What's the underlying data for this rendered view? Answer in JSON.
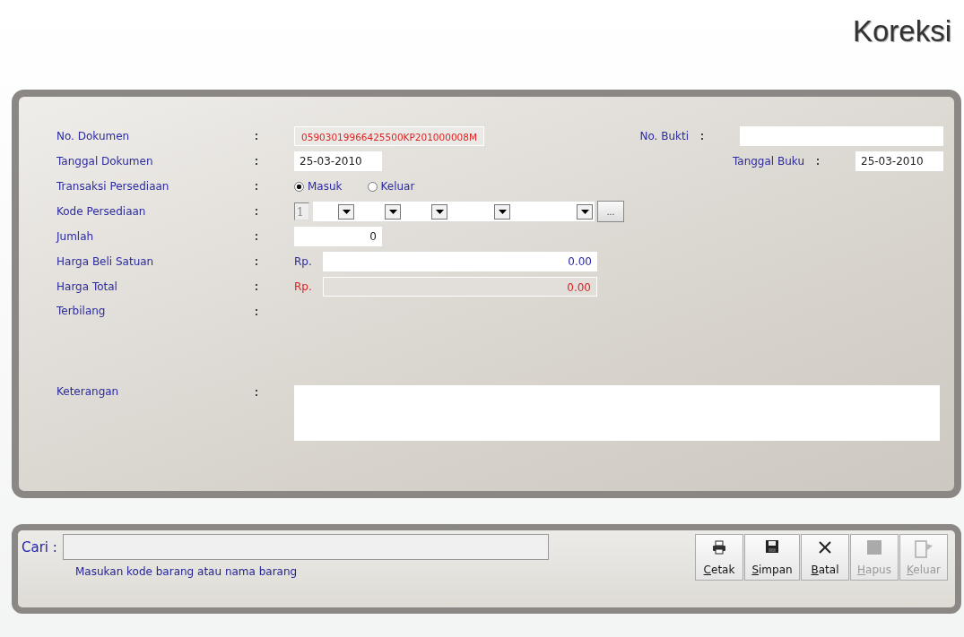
{
  "title": "Koreksi",
  "form": {
    "rows": [
      {
        "kind": "readonly",
        "label": "No. Dokumen",
        "value": "05903019966425500KP201000008M",
        "side": {
          "label": "No. Bukti"
        }
      },
      {
        "kind": "date",
        "label": "Tanggal Dokumen",
        "value": "25-03-2010",
        "side": {
          "label": "Tanggal Buku",
          "value": "25-03-2010"
        }
      },
      {
        "kind": "radio",
        "label": "Transaksi Persediaan",
        "options": [
          {
            "label": "Masuk",
            "selected": true
          },
          {
            "label": "Keluar",
            "selected": false
          }
        ]
      },
      {
        "kind": "code",
        "label": "Kode Persediaan",
        "prefix": "1",
        "browse": "..."
      },
      {
        "kind": "number",
        "label": "Jumlah",
        "value": "0"
      },
      {
        "kind": "amount",
        "label": "Harga Beli Satuan",
        "currency": "Rp.",
        "value": "0.00",
        "disabled": false
      },
      {
        "kind": "amount",
        "label": "Harga Total",
        "currency": "Rp.",
        "value": "0.00",
        "disabled": true
      },
      {
        "kind": "empty",
        "label": "Terbilang"
      },
      {
        "kind": "memo",
        "label": "Keterangan"
      }
    ]
  },
  "search": {
    "label": "Cari :",
    "hint": "Masukan kode barang atau nama barang"
  },
  "buttons": [
    {
      "kind": "print",
      "label": "Cetak",
      "disabled": false
    },
    {
      "kind": "save",
      "label": "Simpan",
      "disabled": false
    },
    {
      "kind": "cancel",
      "label": "Batal",
      "disabled": false
    },
    {
      "kind": "delete",
      "label": "Hapus",
      "disabled": true
    },
    {
      "kind": "exit",
      "label": "Keluar",
      "disabled": true
    }
  ]
}
